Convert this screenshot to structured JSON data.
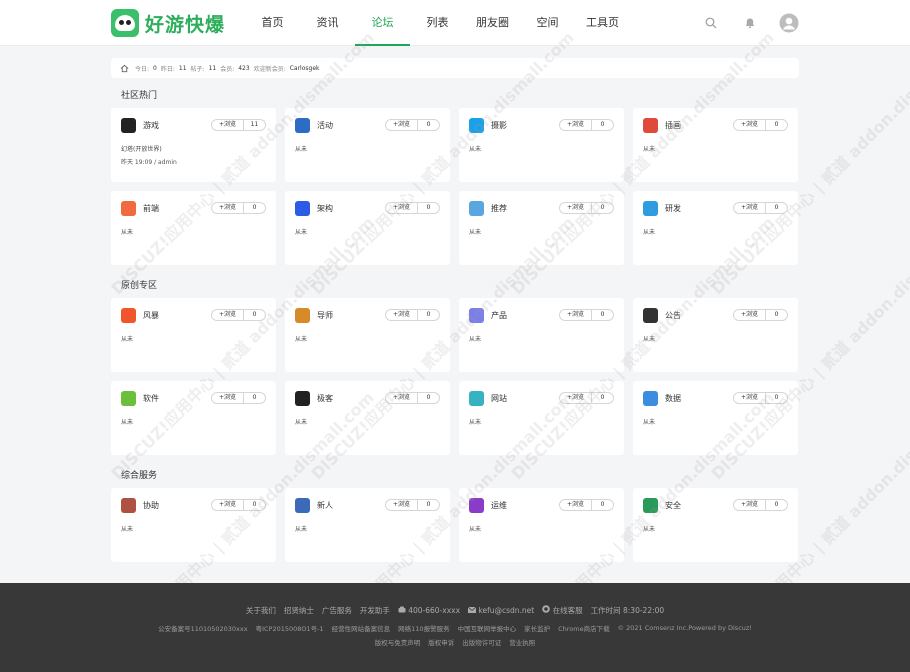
{
  "header": {
    "logo_text": "好游快爆",
    "nav": [
      "首页",
      "资讯",
      "论坛",
      "列表",
      "朋友圈",
      "空间",
      "工具页"
    ],
    "active_index": 2
  },
  "stats": {
    "today_label": "今日:",
    "today": "0",
    "yesterday_label": "昨日:",
    "yesterday": "11",
    "posts_label": "帖子:",
    "posts": "11",
    "members_label": "会员:",
    "members": "423",
    "welcome_label": "欢迎新会员:",
    "newest": "Carlosgek"
  },
  "sections": [
    {
      "title": "社区热门"
    },
    {
      "title": "原创专区"
    },
    {
      "title": "综合服务"
    }
  ],
  "follow_label": "+浏览",
  "never_label": "从未",
  "forums": [
    {
      "name": "游戏",
      "count": "11",
      "desc": "幻塔(开放世界)",
      "meta": "昨天 19:09 / admin",
      "color": "#222"
    },
    {
      "name": "活动",
      "count": "0",
      "color": "#2d6cc4"
    },
    {
      "name": "摄影",
      "count": "0",
      "color": "#1aa0e8"
    },
    {
      "name": "插画",
      "count": "0",
      "color": "#e04a3a"
    },
    {
      "name": "前端",
      "count": "0",
      "color": "#f06b3e"
    },
    {
      "name": "架构",
      "count": "0",
      "color": "#2c5ce6"
    },
    {
      "name": "推荐",
      "count": "0",
      "color": "#5aa6e0"
    },
    {
      "name": "研发",
      "count": "0",
      "color": "#2f9be0"
    },
    {
      "name": "风暴",
      "count": "0",
      "color": "#f0552c"
    },
    {
      "name": "导师",
      "count": "0",
      "color": "#d88a2a"
    },
    {
      "name": "产品",
      "count": "0",
      "color": "#7b7ee8"
    },
    {
      "name": "公告",
      "count": "0",
      "color": "#333"
    },
    {
      "name": "软件",
      "count": "0",
      "color": "#6bbf3a"
    },
    {
      "name": "极客",
      "count": "0",
      "color": "#222"
    },
    {
      "name": "网站",
      "count": "0",
      "color": "#35b3c0"
    },
    {
      "name": "数据",
      "count": "0",
      "color": "#3c8ce0"
    },
    {
      "name": "协助",
      "count": "0",
      "color": "#b05040"
    },
    {
      "name": "新人",
      "count": "0",
      "color": "#3a6ab8"
    },
    {
      "name": "运维",
      "count": "0",
      "color": "#8a3cc8"
    },
    {
      "name": "安全",
      "count": "0",
      "color": "#2a9a5a"
    }
  ],
  "footer": {
    "links": [
      "关于我们",
      "招贤纳士",
      "广告服务",
      "开发助手"
    ],
    "phone": "400-660-xxxx",
    "email": "kefu@csdn.net",
    "service": "在线客服",
    "hours": "工作时间 8:30-22:00",
    "row2": [
      "公安备案号11010502030xxx",
      "粤ICP2015008O1号-1",
      "经营性网站备案信息",
      "网络110报警服务",
      "中国互联网举报中心",
      "家长监护",
      "Chrome商店下载",
      "© 2021 Comsenz Inc.Powered by Discuz!"
    ],
    "row3": [
      "版权与免责声明",
      "版权申诉",
      "出版物许可证",
      "营业执照"
    ]
  },
  "watermark": "DISCUZ!应用中心 | 贰道 addon.dismall.com",
  "colors": {
    "accent": "#21a558",
    "footer_bg": "#383838"
  }
}
